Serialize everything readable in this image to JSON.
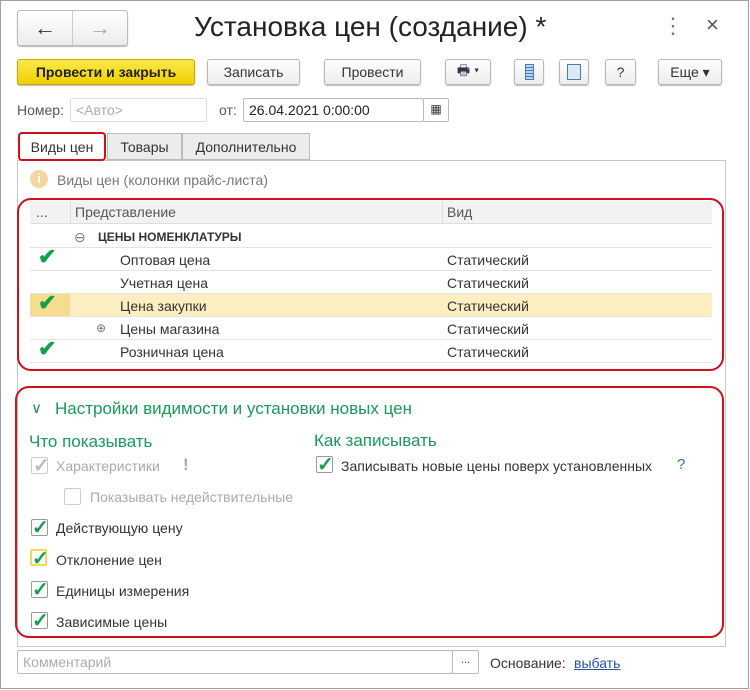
{
  "window": {
    "title": "Установка цен (создание) *",
    "back": "←",
    "forward": "→",
    "more": "⋮",
    "close": "×"
  },
  "toolbar": {
    "post_close": "Провести и закрыть",
    "save": "Записать",
    "post": "Провести",
    "print": "🖶 ▾",
    "q": "?",
    "more": "Еще ▾"
  },
  "header": {
    "number_label": "Номер:",
    "number_placeholder": "<Авто>",
    "date_label": "от:",
    "date_value": "26.04.2021  0:00:00"
  },
  "tabs": [
    "Виды цен",
    "Товары",
    "Дополнительно"
  ],
  "info": "Виды цен (колонки прайс-листа)",
  "table": {
    "columns": [
      "...",
      "Представление",
      "Вид"
    ],
    "group": "ЦЕНЫ НОМЕНКЛАТУРЫ",
    "rows": [
      {
        "name": "Оптовая цена",
        "kind": "Статический",
        "checked": true
      },
      {
        "name": "Учетная цена",
        "kind": "Статический",
        "checked": false
      },
      {
        "name": "Цена закупки",
        "kind": "Статический",
        "checked": true
      },
      {
        "name": "Цены магазина",
        "kind": "Статический",
        "checked": false
      },
      {
        "name": "Розничная цена",
        "kind": "Статический",
        "checked": true
      }
    ]
  },
  "settings": {
    "title": "Настройки видимости и установки новых цен",
    "show_title": "Что показывать",
    "write_title": "Как записывать",
    "characteristics": "Характеристики",
    "show_invalid": "Показывать недействительные",
    "current_price": "Действующую цену",
    "deviation": "Отклонение цен",
    "units": "Единицы измерения",
    "dependent": "Зависимые цены",
    "overwrite": "Записывать новые цены поверх установленных",
    "help": "?"
  },
  "footer": {
    "comment_placeholder": "Комментарий",
    "ellipsis": "...",
    "basis_label": "Основание:",
    "basis_link": "выбать"
  },
  "colors": {
    "accent": "#1a9a5a",
    "highlight": "#d0101a",
    "yellow": "#f5d90e"
  }
}
